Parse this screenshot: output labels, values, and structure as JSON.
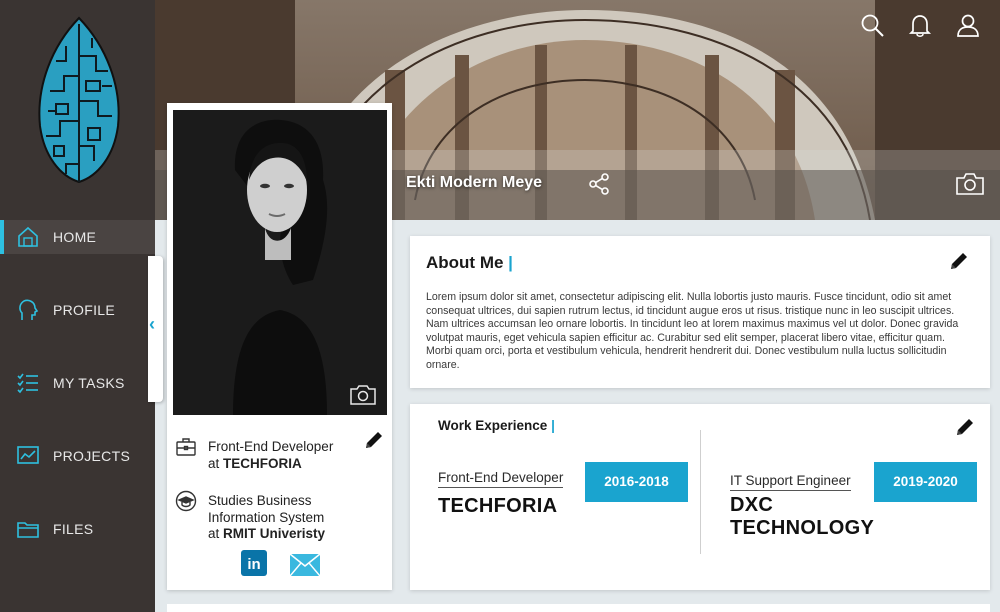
{
  "colors": {
    "accent": "#1aa4cf",
    "sidebar": "#3a3432",
    "background": "#e3e9ec"
  },
  "sidebar": {
    "items": [
      {
        "label": "HOME",
        "icon": "home-icon",
        "active": true
      },
      {
        "label": "PROFILE",
        "icon": "head-profile-icon"
      },
      {
        "label": "MY TASKS",
        "icon": "checklist-icon"
      },
      {
        "label": "PROJECTS",
        "icon": "chart-board-icon"
      },
      {
        "label": "FILES",
        "icon": "folder-icon"
      }
    ]
  },
  "header": {
    "icons": [
      "search-icon",
      "bell-icon",
      "user-icon"
    ]
  },
  "cover": {
    "name": "Ekti Modern Meye",
    "share_icon": "share-icon",
    "camera_icon": "camera-icon"
  },
  "profile": {
    "job_title": "Front-End Developer",
    "job_at_prefix": "at",
    "job_company": "TECHFORIA",
    "study_line1": "Studies Business",
    "study_line2": "Information System",
    "study_at_prefix": "at",
    "study_school": "RMIT Univeristy",
    "social_icons": [
      "linkedin-icon",
      "mail-icon"
    ]
  },
  "about": {
    "title": "About Me",
    "text": "Lorem ipsum dolor sit amet, consectetur adipiscing elit. Nulla lobortis justo mauris. Fusce tincidunt, odio sit amet consequat ultrices, dui sapien rutrum lectus, id tincidunt augue eros ut risus. tristique nunc in leo suscipit ultrices. Nam ultrices accumsan leo ornare lobortis. In tincidunt leo at lorem maximus maximus vel ut dolor. Donec gravida volutpat mauris, eget vehicula sapien efficitur ac. Curabitur sed elit semper, placerat libero vitae, efficitur quam. Morbi quam orci, porta et vestibulum vehicula, hendrerit hendrerit dui. Donec vestibulum nulla luctus sollicitudin ornare."
  },
  "work": {
    "title": "Work Experience",
    "jobs": [
      {
        "role": "Front-End Developer",
        "company": "TECHFORIA",
        "years": "2016-2018"
      },
      {
        "role": "IT Support Engineer",
        "company_line1": "DXC",
        "company_line2": "TECHNOLOGY",
        "years": "2019-2020"
      }
    ]
  }
}
